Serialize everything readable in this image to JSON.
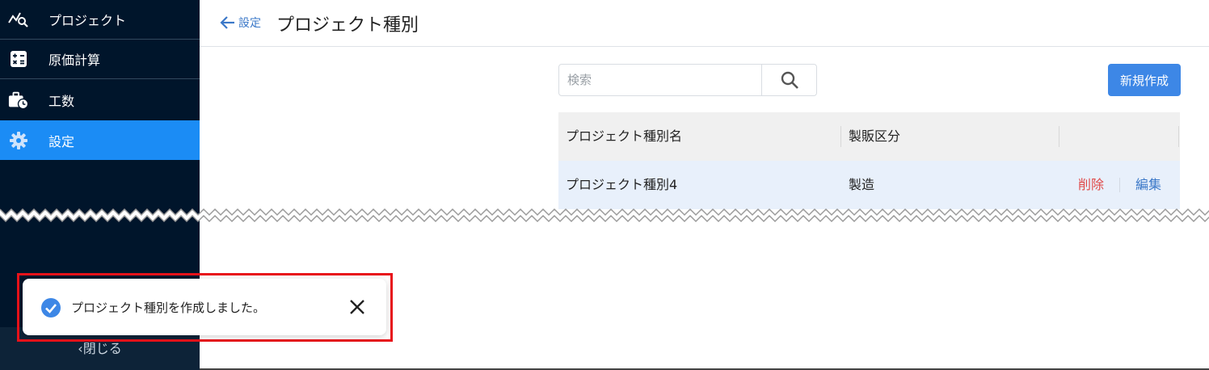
{
  "sidebar": {
    "items": [
      {
        "label": "プロジェクト",
        "icon": "chart-search-icon"
      },
      {
        "label": "原価計算",
        "icon": "calculator-icon"
      },
      {
        "label": "工数",
        "icon": "briefcase-clock-icon"
      },
      {
        "label": "設定",
        "icon": "gear-icon",
        "active": true
      }
    ],
    "close_label": "‹閉じる"
  },
  "header": {
    "back_label": "設定",
    "title": "プロジェクト種別"
  },
  "search": {
    "placeholder": "検索",
    "value": ""
  },
  "toolbar": {
    "new_label": "新規作成"
  },
  "table": {
    "columns": [
      "プロジェクト種別名",
      "製販区分",
      ""
    ],
    "rows": [
      {
        "name": "プロジェクト種別4",
        "category": "製造",
        "delete_label": "削除",
        "edit_label": "編集"
      }
    ]
  },
  "toast": {
    "message": "プロジェクト種別を作成しました。"
  },
  "colors": {
    "sidebar_bg": "#00152b",
    "active_item": "#1b8cf5",
    "primary": "#3d87e6",
    "danger": "#e04a4a",
    "highlight_frame": "#e8121a",
    "row_selected": "#e8f0fb"
  }
}
